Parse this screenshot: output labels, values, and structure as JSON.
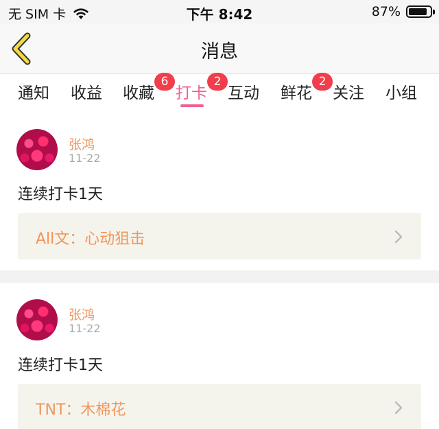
{
  "status_bar": {
    "carrier": "无 SIM 卡",
    "time": "下午 8:42",
    "battery": "87%"
  },
  "nav": {
    "title": "消息"
  },
  "tabs": [
    {
      "label": "通知",
      "badge": ""
    },
    {
      "label": "收益",
      "badge": ""
    },
    {
      "label": "收藏",
      "badge": "6"
    },
    {
      "label": "打卡",
      "badge": "2",
      "active": true
    },
    {
      "label": "互动",
      "badge": ""
    },
    {
      "label": "鲜花",
      "badge": "2"
    },
    {
      "label": "关注",
      "badge": ""
    },
    {
      "label": "小组",
      "badge": ""
    }
  ],
  "cards": [
    {
      "user": "张鸿",
      "date": "11-22",
      "text": "连续打卡1天",
      "work": "All文：心动狙击"
    },
    {
      "user": "张鸿",
      "date": "11-22",
      "text": "连续打卡1天",
      "work": "TNT：木棉花"
    }
  ],
  "colors": {
    "accent": "#f06292",
    "badge": "#f23d4c",
    "name": "#f0955a"
  }
}
